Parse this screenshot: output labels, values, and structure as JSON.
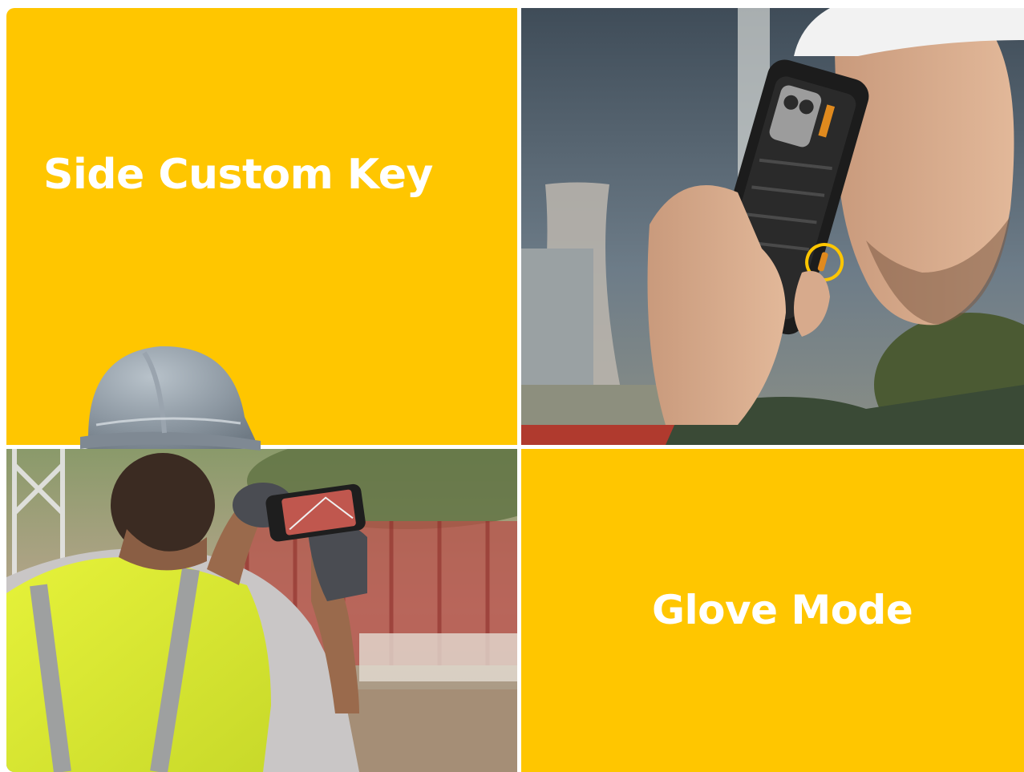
{
  "features": [
    {
      "id": "side-custom-key",
      "label": "Side Custom Key"
    },
    {
      "id": "glove-mode",
      "label": "Glove Mode"
    }
  ],
  "colors": {
    "accent": "#FFC600",
    "text": "#FFFFFF"
  },
  "icons": [
    "hard-hat-icon",
    "smartphone-icon",
    "gloved-hand-icon"
  ]
}
